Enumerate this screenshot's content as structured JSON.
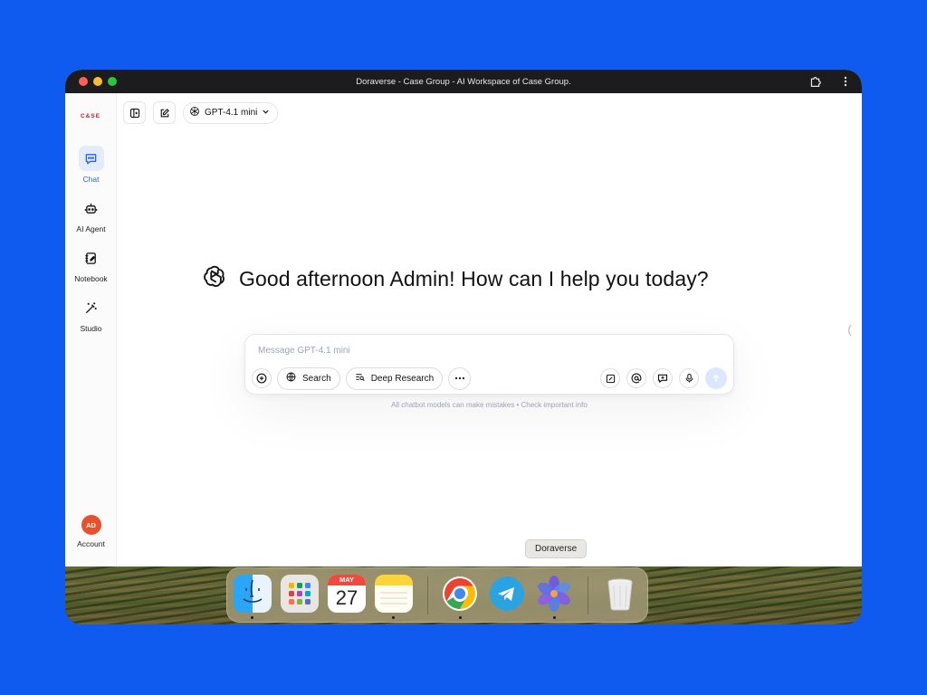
{
  "window": {
    "title": "Doraverse - Case Group - AI Workspace of Case Group."
  },
  "sidebar": {
    "logo_text": "C&SE",
    "items": [
      {
        "label": "Chat",
        "icon": "chat-icon",
        "active": true
      },
      {
        "label": "AI Agent",
        "icon": "robot-icon",
        "active": false
      },
      {
        "label": "Notebook",
        "icon": "notebook-icon",
        "active": false
      },
      {
        "label": "Studio",
        "icon": "magic-wand-icon",
        "active": false
      }
    ],
    "account": {
      "initials": "AD",
      "label": "Account"
    }
  },
  "topbar": {
    "model_name": "GPT-4.1 mini"
  },
  "main": {
    "greeting": "Good afternoon Admin! How can I help you today?"
  },
  "composer": {
    "placeholder": "Message GPT-4.1 mini",
    "search_label": "Search",
    "deep_research_label": "Deep Research"
  },
  "disclaimer": "All chatbot models can make mistakes • Check important info",
  "dock": {
    "tooltip": "Doraverse",
    "calendar": {
      "month": "MAY",
      "day": "27"
    },
    "apps": [
      "Finder",
      "Launchpad",
      "Calendar",
      "Notes",
      "Chrome",
      "Telegram",
      "Doraverse",
      "Trash"
    ]
  },
  "colors": {
    "background": "#0F5BF0",
    "accent": "#2563eb",
    "avatar": "#e8512d",
    "logo": "#b3202c"
  }
}
